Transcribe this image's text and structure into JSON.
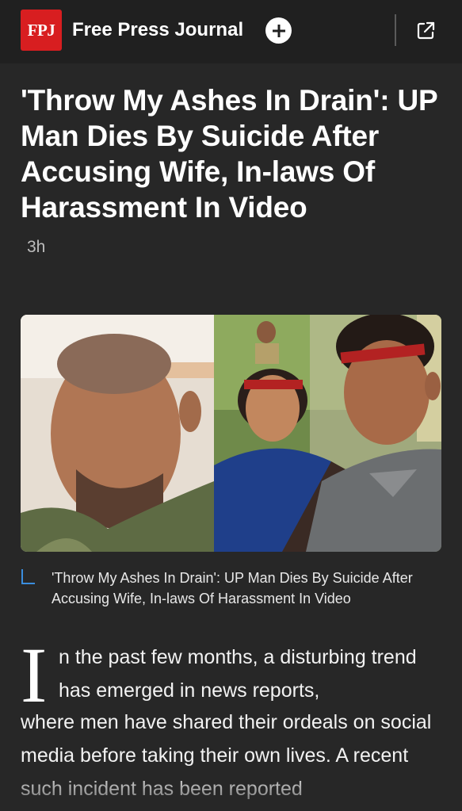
{
  "header": {
    "logo_text": "FPJ",
    "brand_name": "Free Press Journal",
    "follow_icon": "plus-circle-icon",
    "share_icon": "open-external-icon",
    "brand_color": "#d81e20"
  },
  "article": {
    "title": "'Throw My Ashes In Drain': UP Man Dies By Suicide After Accusing Wife, In-laws Of Harassment In Video",
    "age": "3h",
    "image_caption": "'Throw My Ashes In Drain': UP Man Dies By Suicide After Accusing Wife, In-laws Of Harassment In Video",
    "dropcap": "I",
    "body_lead": "n the past few months, a disturbing trend has emerged in news reports,",
    "body_rest": "where men have shared their ordeals on social media before taking their own lives. A recent such incident has been reported"
  }
}
